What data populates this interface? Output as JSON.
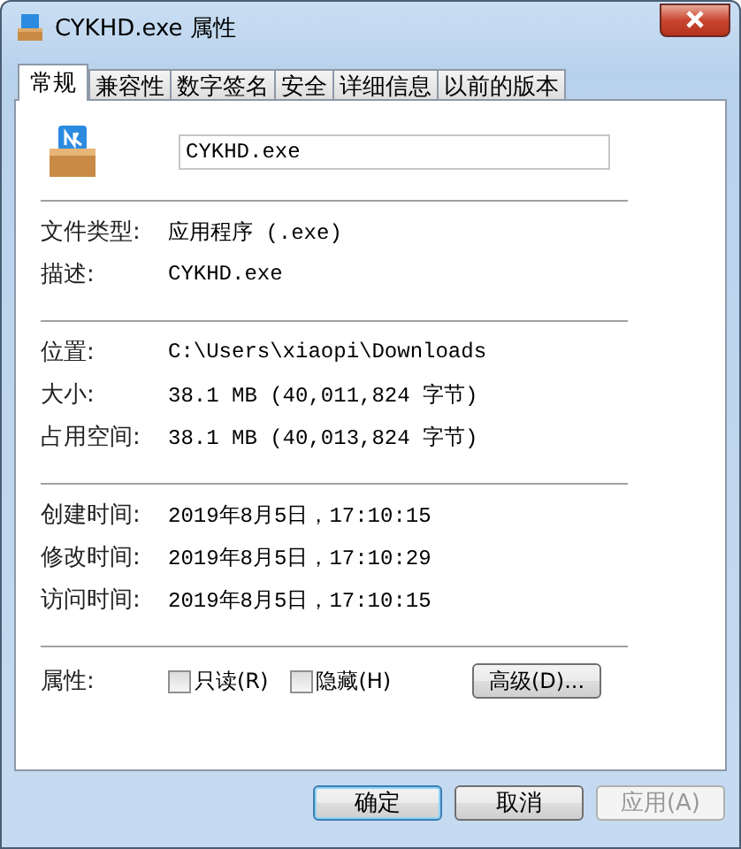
{
  "window": {
    "title": "CYKHD.exe 属性"
  },
  "tabs": [
    {
      "label": "常规",
      "selected": true
    },
    {
      "label": "兼容性",
      "selected": false
    },
    {
      "label": "数字签名",
      "selected": false
    },
    {
      "label": "安全",
      "selected": false
    },
    {
      "label": "详细信息",
      "selected": false
    },
    {
      "label": "以前的版本",
      "selected": false
    }
  ],
  "file_name": {
    "value": "CYKHD.exe"
  },
  "sections": [
    {
      "rows": [
        {
          "label": "文件类型:",
          "value": "应用程序 (.exe)"
        },
        {
          "label": "描述:",
          "value": "CYKHD.exe"
        }
      ]
    },
    {
      "rows": [
        {
          "label": "位置:",
          "value": "C:\\Users\\xiaopi\\Downloads"
        },
        {
          "label": "大小:",
          "value": "38.1 MB (40,011,824 字节)"
        },
        {
          "label": "占用空间:",
          "value": "38.1 MB (40,013,824 字节)"
        }
      ]
    },
    {
      "rows": [
        {
          "label": "创建时间:",
          "value": "2019年8月5日，17:10:15"
        },
        {
          "label": "修改时间:",
          "value": "2019年8月5日，17:10:29"
        },
        {
          "label": "访问时间:",
          "value": "2019年8月5日，17:10:15"
        }
      ]
    }
  ],
  "attributes": {
    "label": "属性:",
    "checkboxes": [
      {
        "label": "只读(R)",
        "checked": false
      },
      {
        "label": "隐藏(H)",
        "checked": false
      }
    ],
    "advanced_button": "高级(D)..."
  },
  "buttons": [
    {
      "label": "确定",
      "disabled": false,
      "default": true
    },
    {
      "label": "取消",
      "disabled": false,
      "default": false
    },
    {
      "label": "应用(A)",
      "disabled": true,
      "default": false
    }
  ]
}
